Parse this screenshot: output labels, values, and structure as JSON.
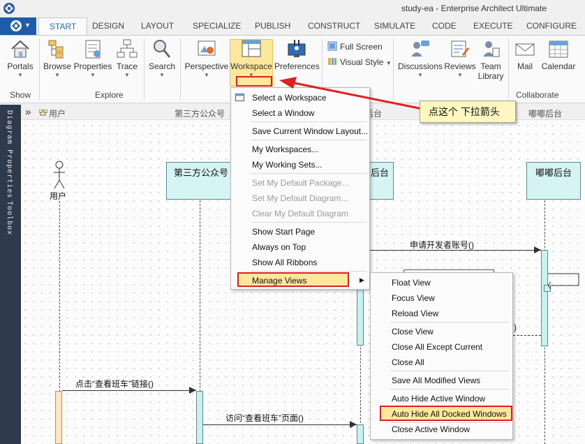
{
  "window": {
    "title": "study-ea - Enterprise Architect Ultimate"
  },
  "tabs": [
    "START",
    "DESIGN",
    "LAYOUT",
    "SPECIALIZE",
    "PUBLISH",
    "CONSTRUCT",
    "SIMULATE",
    "CODE",
    "EXECUTE",
    "CONFIGURE"
  ],
  "active_tab": "START",
  "ribbon": {
    "portals": "Portals",
    "browse": "Browse",
    "properties": "Properties",
    "trace": "Trace",
    "search": "Search",
    "perspective": "Perspective",
    "workspace": "Workspace",
    "preferences": "Preferences",
    "full_screen": "Full Screen",
    "visual_style": "Visual Style",
    "discussions": "Discussions",
    "reviews": "Reviews",
    "team": "Team",
    "library": "Library",
    "mail": "Mail",
    "calendar": "Calendar",
    "groups": {
      "show": "Show",
      "explore": "Explore",
      "collaborate": "Collaborate"
    }
  },
  "sidebar": {
    "diagram_properties": "Diagram Properties",
    "toolbox": "Toolbox"
  },
  "diagram": {
    "header": {
      "chevron": "»",
      "actor": "用户",
      "col2": "第三方公众号",
      "col3": "后台",
      "col4": "嘟嘟后台"
    },
    "actor_name": "用户",
    "lifeline_boxes": {
      "third_party": "第三方公众号",
      "backend": "后台",
      "dudu_backend": "嘟嘟后台"
    },
    "messages": {
      "apply_dev": "申请开发者账号()",
      "partial_close": ")",
      "click_link": "点击“查看班车”链接()",
      "visit_page": "访问“查看班车”页面()"
    }
  },
  "workspace_menu": {
    "items": [
      {
        "label": "Select a Workspace",
        "disabled": false
      },
      {
        "label": "Select a Window",
        "disabled": false
      },
      {
        "label": "Save Current Window Layout...",
        "disabled": false
      },
      {
        "label": "My Workspaces...",
        "disabled": false
      },
      {
        "label": "My Working Sets...",
        "disabled": false
      },
      {
        "label": "Set My Default Package...",
        "disabled": true
      },
      {
        "label": "Set My Default Diagram...",
        "disabled": true
      },
      {
        "label": "Clear My Default Diagram",
        "disabled": true
      },
      {
        "label": "Show Start Page",
        "disabled": false
      },
      {
        "label": "Always on Top",
        "disabled": false
      },
      {
        "label": "Show All Ribbons",
        "disabled": false
      },
      {
        "label": "Manage Views",
        "disabled": false
      }
    ]
  },
  "manage_views_menu": {
    "items": [
      "Float View",
      "Focus View",
      "Reload View",
      "Close View",
      "Close All Except Current",
      "Close All",
      "Save All Modified Views",
      "Auto Hide Active Window",
      "Auto Hide All Docked Windows",
      "Close Active Window"
    ]
  },
  "callout": {
    "text": "点这个 下拉箭头"
  },
  "colors": {
    "highlight": "#fde79a",
    "annotation_red": "#e02020",
    "accent": "#1d5ca8"
  }
}
